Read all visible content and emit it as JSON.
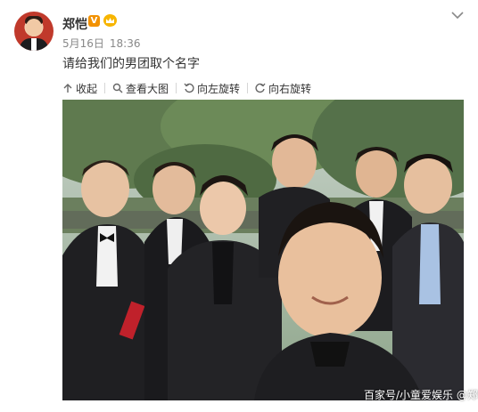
{
  "post": {
    "username": "郑恺",
    "verified_badge": "V",
    "date": "5月16日",
    "time": "18:36",
    "text": "请给我们的男团取个名字"
  },
  "toolbar": {
    "collect": "收起",
    "view_large": "查看大图",
    "rotate_left": "向左旋转",
    "rotate_right": "向右旋转"
  },
  "image": {
    "watermark": "百家号/小童爱娱乐  @郑恺"
  },
  "icons": {
    "collect": "collapse-up-icon",
    "view_large": "search-icon",
    "rotate_left": "rotate-left-icon",
    "rotate_right": "rotate-right-icon",
    "menu": "chevron-down-icon"
  },
  "colors": {
    "username": "#333333",
    "meta": "#888888",
    "vbadge": "#f29100",
    "crown": "#f7b500"
  }
}
